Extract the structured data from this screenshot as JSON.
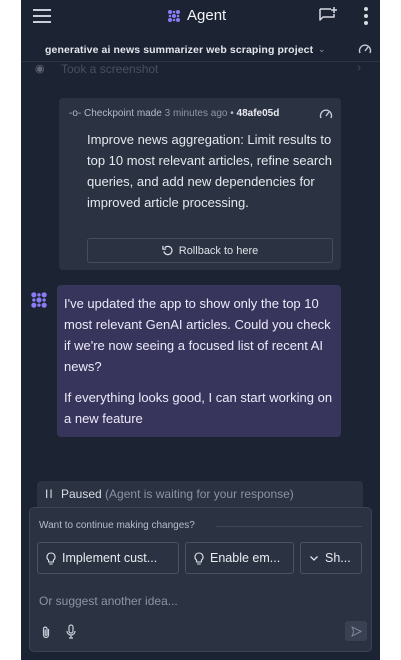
{
  "header": {
    "title": "Agent",
    "project_name": "generative ai news summarizer web scraping project",
    "faded_row_text": "Took a screenshot"
  },
  "checkpoint": {
    "made_label": "Checkpoint made",
    "time_ago": "3 minutes ago",
    "separator": "•",
    "commit_id": "48afe05d",
    "description": "Improve news aggregation: Limit results to top 10 most relevant articles, refine search queries, and add new dependencies for improved article processing.",
    "rollback_label": "Rollback to here"
  },
  "agent_message": {
    "paragraph1": "I've updated the app to show only the top 10 most relevant GenAI articles. Could you check if we're now seeing a focused list of recent AI news?",
    "paragraph2": "If everything looks good, I can start working on a new feature"
  },
  "status": {
    "paused_label": "Paused",
    "paused_reason": "(Agent is waiting for your response)"
  },
  "suggestions": {
    "heading": "Want to continue making changes?",
    "chips": [
      {
        "label": "Implement cust...",
        "icon": "lightbulb-icon"
      },
      {
        "label": "Enable em...",
        "icon": "lightbulb-icon"
      },
      {
        "label": "Sh...",
        "icon": "chevron-down-icon"
      }
    ]
  },
  "input": {
    "placeholder": "Or suggest another idea..."
  },
  "colors": {
    "background": "#1c2333",
    "card": "#2b3242",
    "agent_bubble": "#37355c",
    "agent_logo": "#8b7cf6"
  }
}
